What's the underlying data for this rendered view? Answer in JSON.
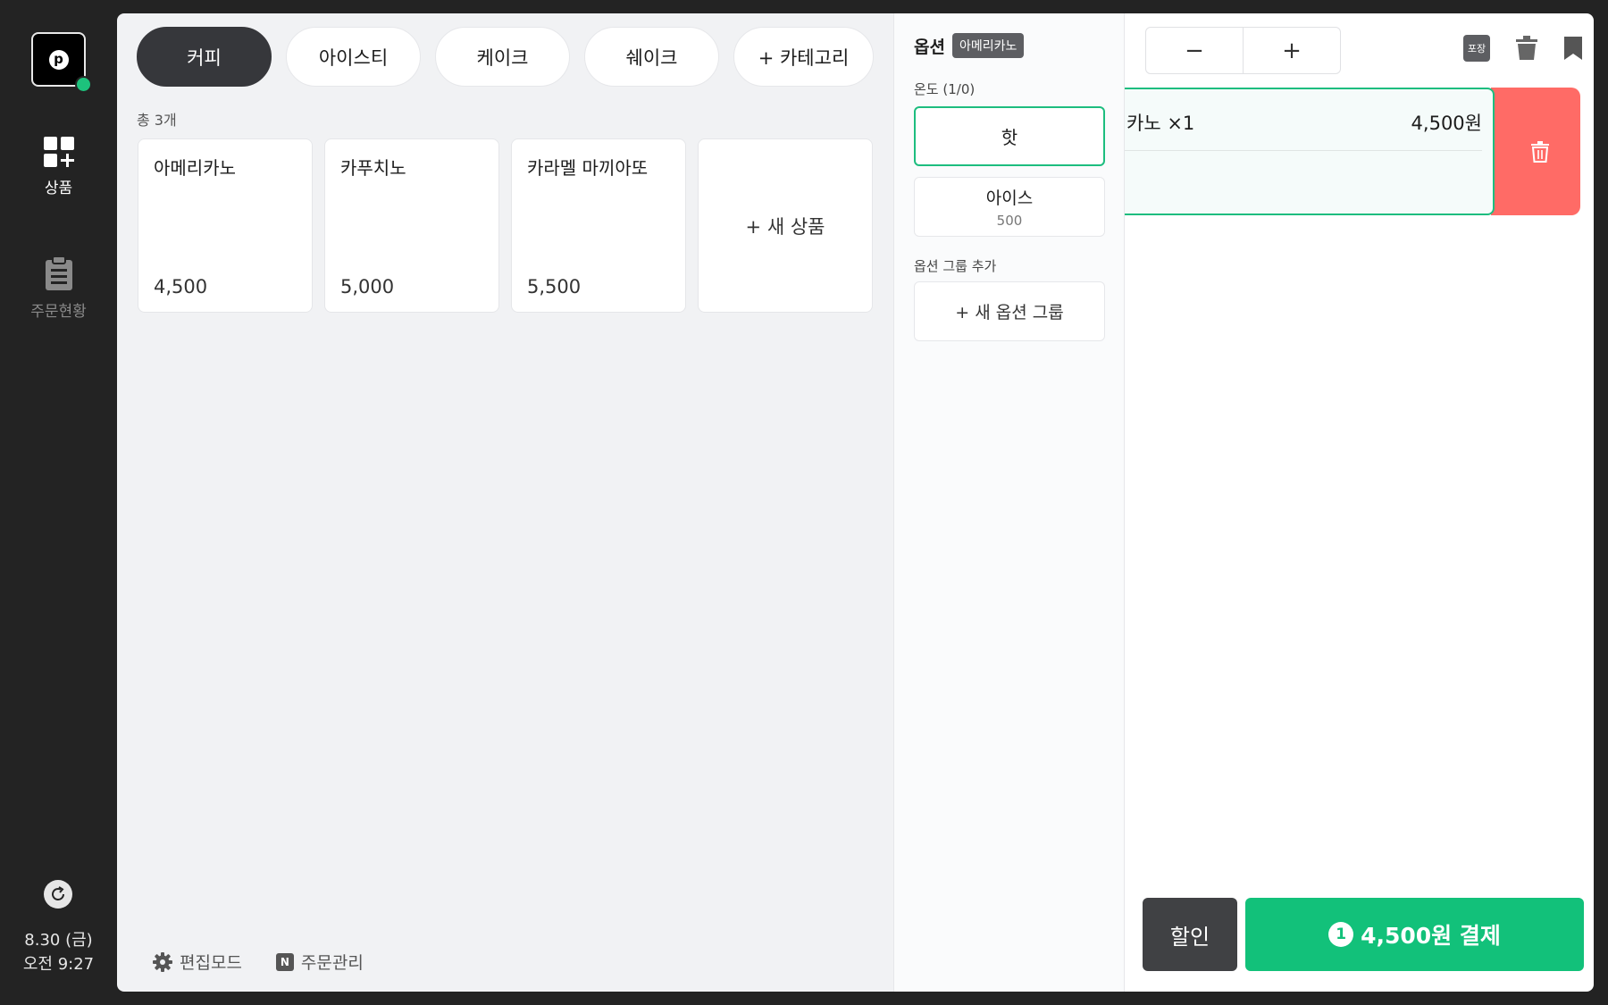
{
  "sidebar": {
    "nav": [
      {
        "label": "상품",
        "icon": "grid-add-icon",
        "active": true
      },
      {
        "label": "주문현황",
        "icon": "clipboard-icon",
        "active": false
      }
    ],
    "date": "8.30 (금)",
    "time": "오전  9:27"
  },
  "main": {
    "tabs": [
      {
        "label": "커피",
        "active": true
      },
      {
        "label": "아이스티",
        "active": false
      },
      {
        "label": "케이크",
        "active": false
      },
      {
        "label": "쉐이크",
        "active": false
      },
      {
        "label": "+ 카테고리",
        "active": false
      }
    ],
    "count": "총 3개",
    "products": [
      {
        "name": "아메리카노",
        "price": "4,500"
      },
      {
        "name": "카푸치노",
        "price": "5,000"
      },
      {
        "name": "카라멜 마끼아또",
        "price": "5,500"
      }
    ],
    "new_product": "+ 새 상품",
    "footer": {
      "edit_mode": "편집모드",
      "order_manage": "주문관리",
      "order_manage_badge": "N"
    }
  },
  "options": {
    "title": "옵션",
    "product_chip": "아메리카노",
    "temp_label": "온도 (1/0)",
    "hot": "핫",
    "ice": "아이스",
    "ice_price": "500",
    "group_label": "옵션 그룹 추가",
    "new_group": "+ 새 옵션 그룹"
  },
  "cart": {
    "minus": "−",
    "plus": "+",
    "pack_label": "포장",
    "item": {
      "name": "카노 ×1",
      "price": "4,500원"
    },
    "discount": "할인",
    "pay_count": "1",
    "pay_label": "4,500원 결제"
  },
  "colors": {
    "accent": "#12c17a",
    "delete": "#ff6b66",
    "dark": "#232323"
  }
}
